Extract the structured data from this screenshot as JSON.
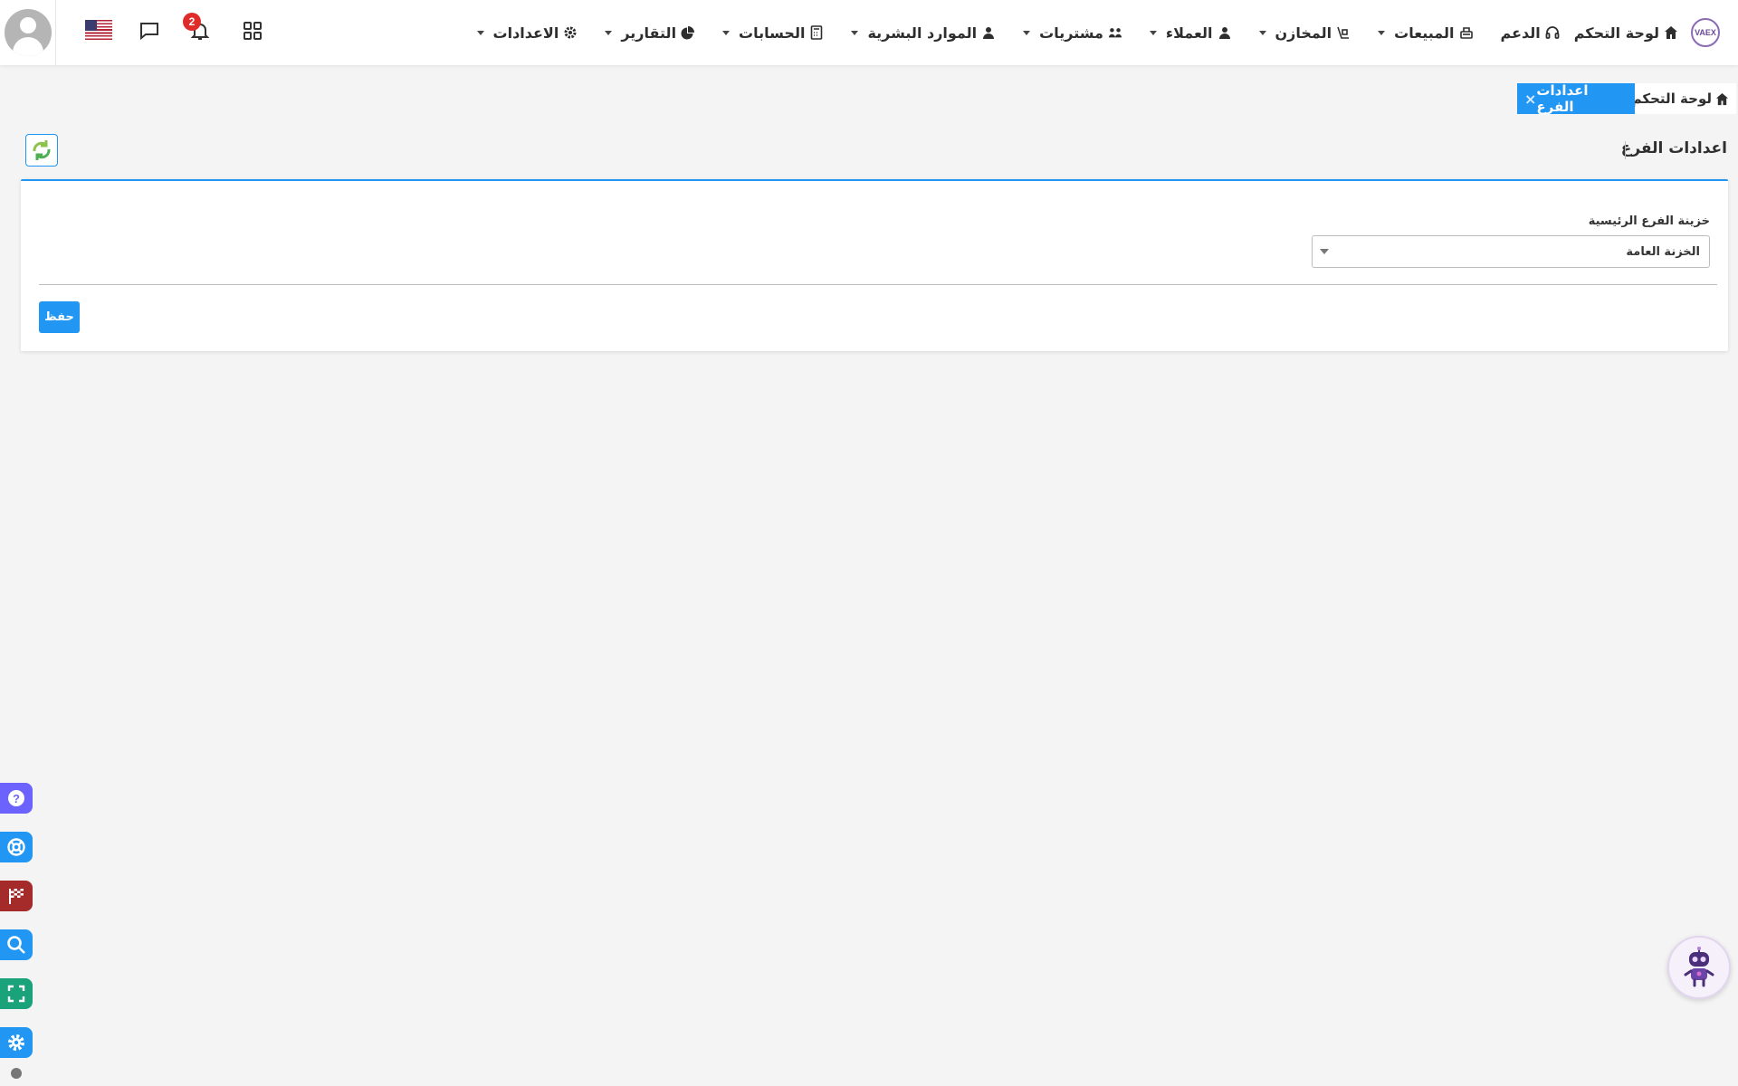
{
  "navbar": {
    "logo_text": "VAEX",
    "notifications_count": "2",
    "menu": [
      {
        "label": "لوحة التحكم",
        "icon": "home-icon",
        "has_dropdown": false
      },
      {
        "label": "الدعم",
        "icon": "headset-icon",
        "has_dropdown": false
      },
      {
        "label": "المبيعات",
        "icon": "cash-register-icon",
        "has_dropdown": true
      },
      {
        "label": "المخازن",
        "icon": "boxes-icon",
        "has_dropdown": true
      },
      {
        "label": "العملاء",
        "icon": "user-icon",
        "has_dropdown": true
      },
      {
        "label": "مشتريات",
        "icon": "people-group-icon",
        "has_dropdown": true
      },
      {
        "label": "الموارد البشرية",
        "icon": "user-tie-icon",
        "has_dropdown": true
      },
      {
        "label": "الحسابات",
        "icon": "calculator-icon",
        "has_dropdown": true
      },
      {
        "label": "التقارير",
        "icon": "pie-chart-icon",
        "has_dropdown": true
      },
      {
        "label": "الاعدادات",
        "icon": "gear-icon",
        "has_dropdown": true
      }
    ]
  },
  "tabs": {
    "home_label": "لوحة التحكم",
    "active_label": "اعدادات الفرع",
    "close_glyph": "×"
  },
  "page": {
    "title": "اعدادات الفرع"
  },
  "form": {
    "treasury_label": "خزينة الفرع الرئيسية",
    "treasury_value": "الخزنة العامة",
    "save_label": "حفظ"
  },
  "side_tools": [
    {
      "name": "help-icon",
      "color": "#6c63ff"
    },
    {
      "name": "lifebuoy-icon",
      "color": "#2196f3"
    },
    {
      "name": "checkered-flag-icon",
      "color": "#a52a2a"
    },
    {
      "name": "search-icon",
      "color": "#2196f3"
    },
    {
      "name": "fullscreen-icon",
      "color": "#1aa37a"
    },
    {
      "name": "gear-icon",
      "color": "#2196f3"
    }
  ],
  "colors": {
    "accent": "#2196f3",
    "badge": "#e02b2b"
  }
}
